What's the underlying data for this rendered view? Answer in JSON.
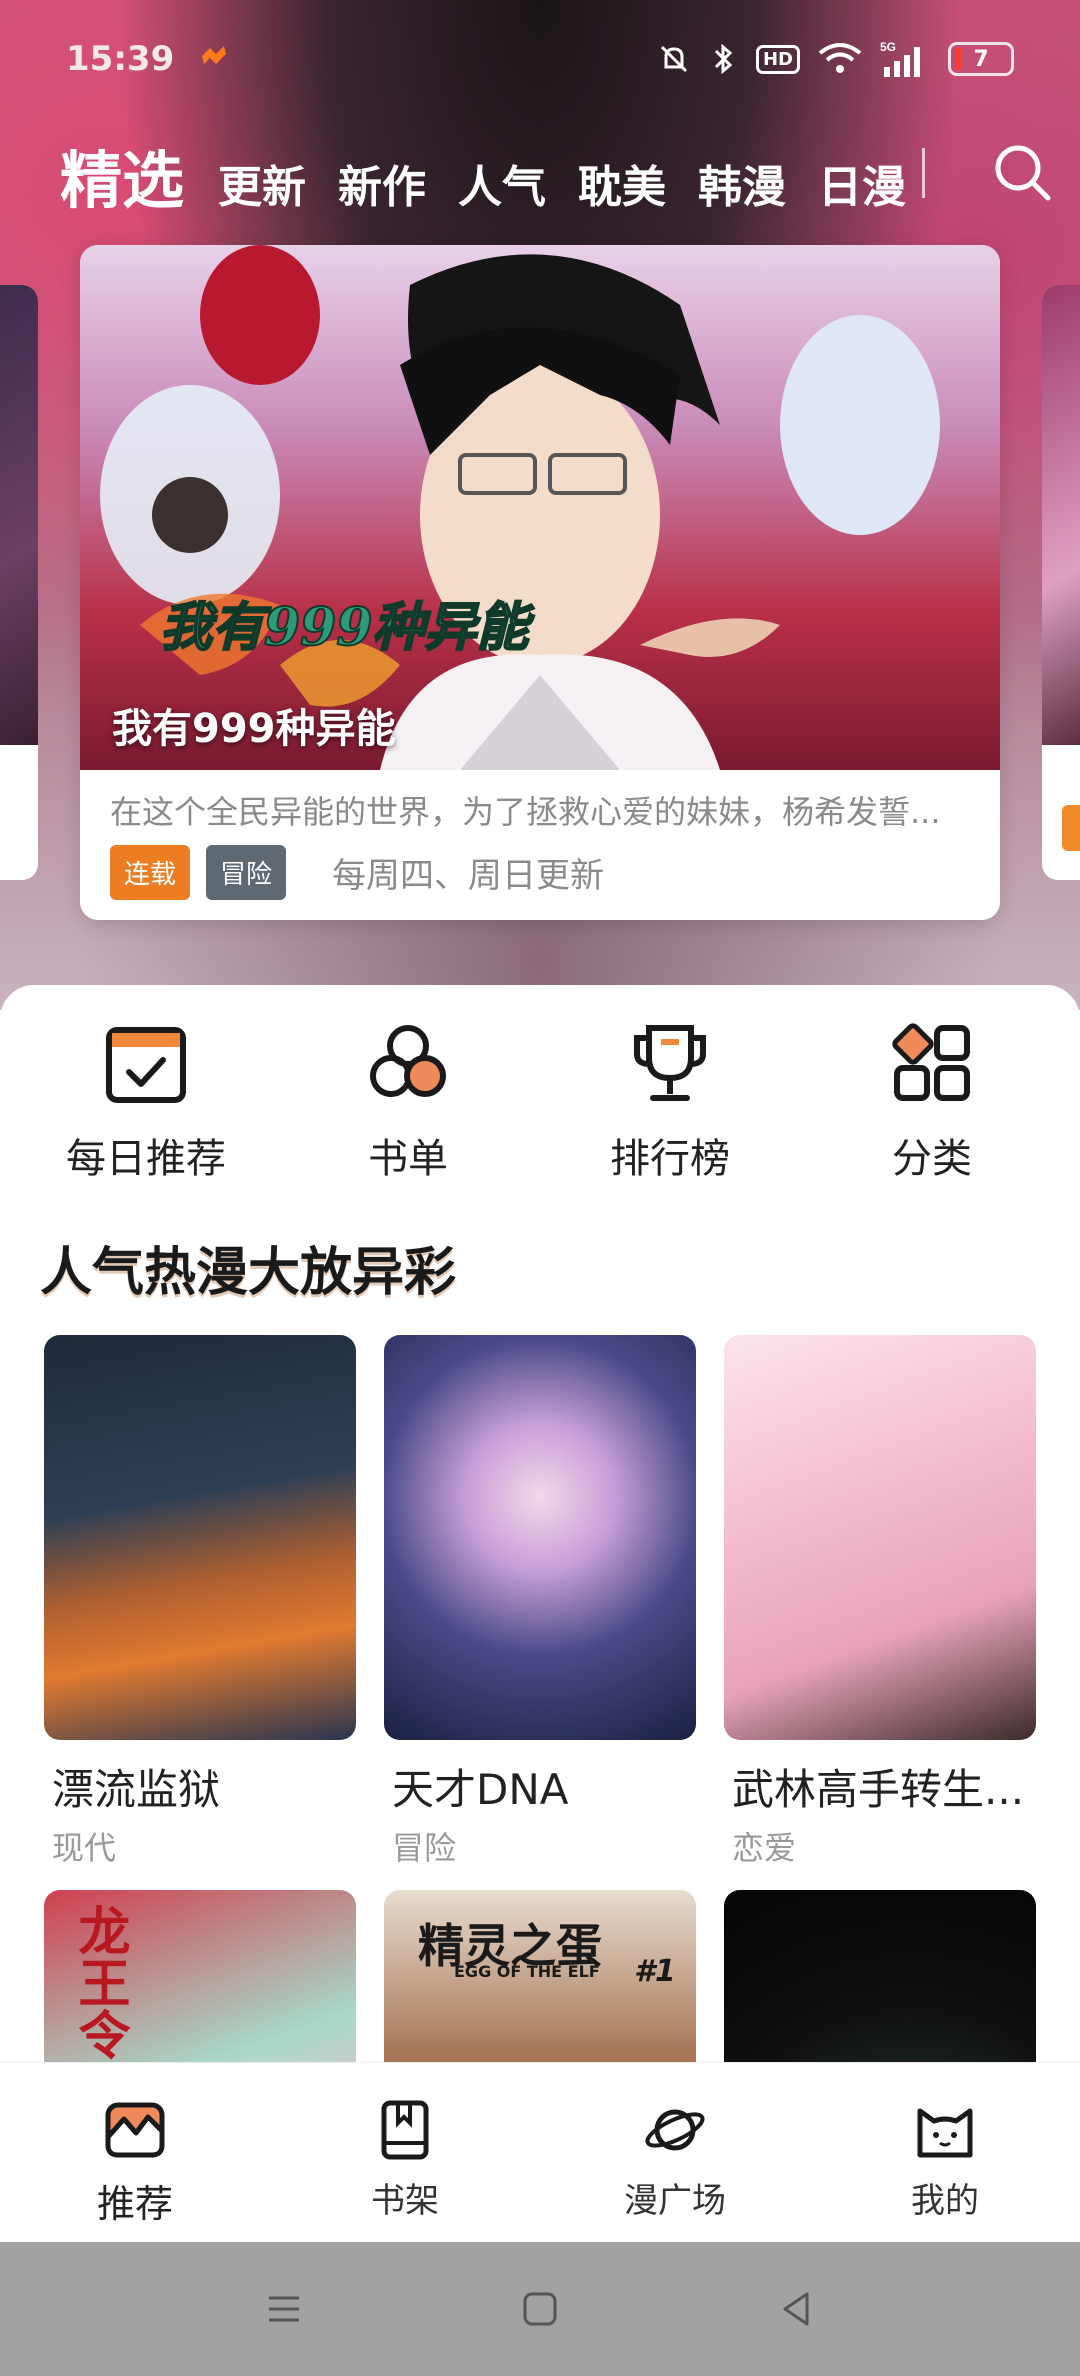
{
  "status_bar": {
    "time": "15:39",
    "hd_label": "HD",
    "battery": "7",
    "network": "5G"
  },
  "top_tabs": [
    "精选",
    "更新",
    "新作",
    "人气",
    "耽美",
    "韩漫",
    "日漫"
  ],
  "featured": {
    "title": "我有999种异能",
    "description": "在这个全民异能的世界，为了拯救心爱的妹妹，杨希发誓...",
    "badges": [
      "连载",
      "冒险"
    ],
    "update_schedule": "每周四、周日更新",
    "cover_logo_text": "我有999种异能"
  },
  "shortcuts": [
    {
      "label": "每日推荐",
      "icon": "calendar-check-icon"
    },
    {
      "label": "书单",
      "icon": "circles-icon"
    },
    {
      "label": "排行榜",
      "icon": "trophy-icon"
    },
    {
      "label": "分类",
      "icon": "category-icon"
    }
  ],
  "section": {
    "title": "人气热漫大放异彩"
  },
  "books": [
    {
      "title": "漂流监狱",
      "genre": "现代"
    },
    {
      "title": "天才DNA",
      "genre": "冒险"
    },
    {
      "title": "武林高手转生...",
      "genre": "恋爱"
    },
    {
      "title": "",
      "genre": "",
      "cover_text": "龙王令"
    },
    {
      "title": "",
      "genre": "",
      "cover_text": "精灵之蛋",
      "cover_subtext": "EGG OF THE ELF",
      "cover_mark": "#1"
    },
    {
      "title": "",
      "genre": ""
    }
  ],
  "bottom_nav": [
    {
      "label": "推荐",
      "icon": "recommend-icon",
      "active": true
    },
    {
      "label": "书架",
      "icon": "bookshelf-icon"
    },
    {
      "label": "漫广场",
      "icon": "planet-icon"
    },
    {
      "label": "我的",
      "icon": "cat-face-icon"
    }
  ],
  "colors": {
    "accent": "#ec7d23",
    "badge_gray": "#5e6870",
    "system_nav": "#a2a2a4"
  }
}
